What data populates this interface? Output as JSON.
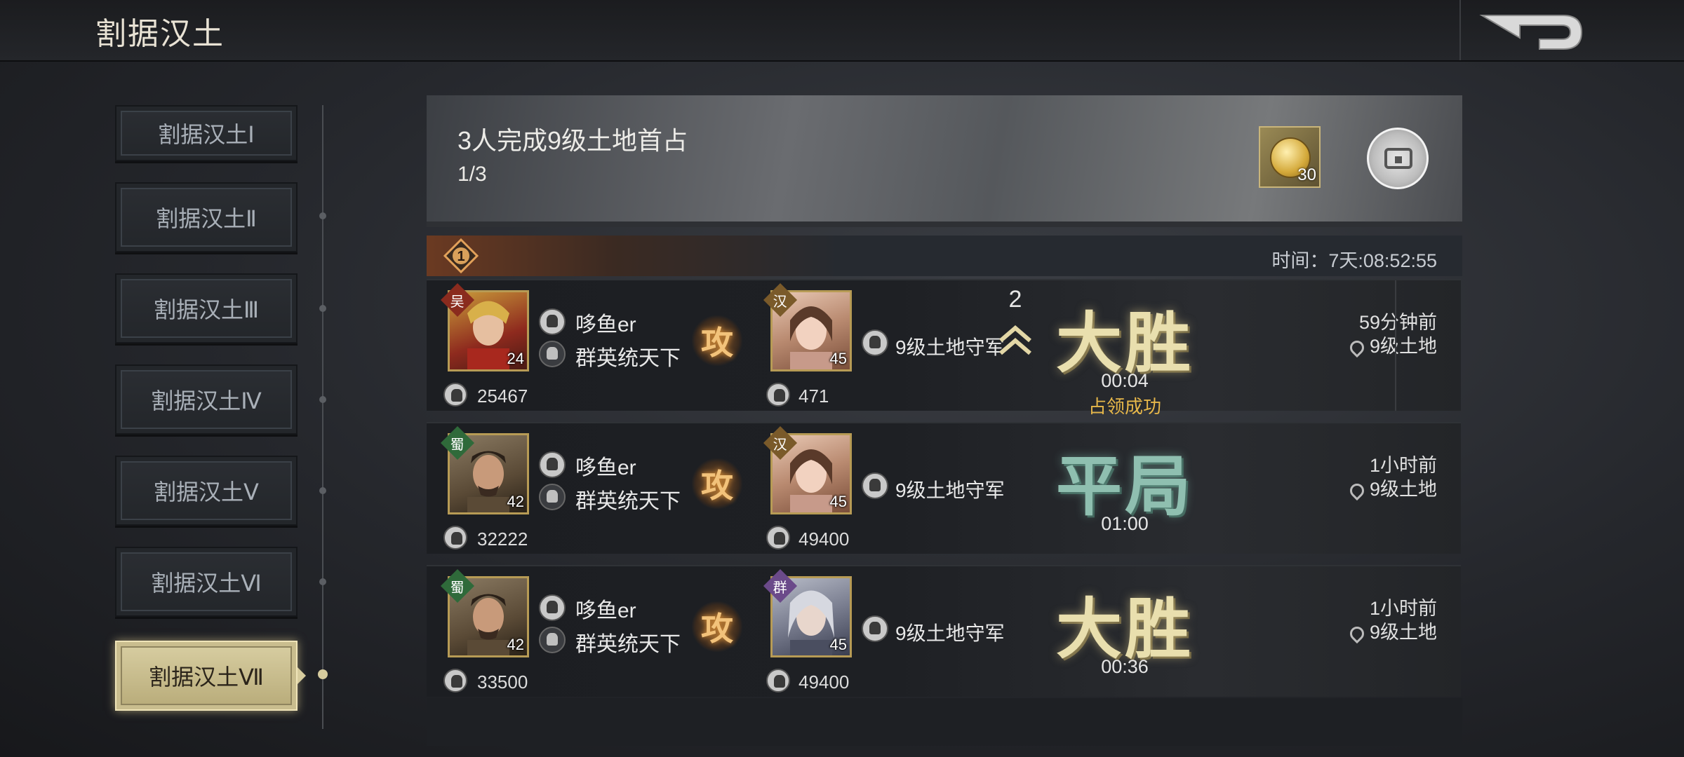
{
  "header": {
    "title": "割据汉土"
  },
  "sidebar": {
    "items": [
      {
        "label": "割据汉土Ⅰ"
      },
      {
        "label": "割据汉土Ⅱ"
      },
      {
        "label": "割据汉土Ⅲ"
      },
      {
        "label": "割据汉土Ⅳ"
      },
      {
        "label": "割据汉土Ⅴ"
      },
      {
        "label": "割据汉土Ⅵ"
      },
      {
        "label": "割据汉土Ⅶ"
      }
    ],
    "active_index": 6
  },
  "banner": {
    "title": "3人完成9级土地首占",
    "progress": "1/3",
    "reward_count": "30",
    "reward_icon": "gold-coin-icon",
    "chest_icon": "treasure-chest-icon"
  },
  "round": {
    "number": "1",
    "time_label": "时间：7天:08:52:55"
  },
  "battles": [
    {
      "attacker_faction": "吴",
      "attacker_level": "24",
      "attacker_name": "哆鱼er",
      "attacker_alliance": "群英统天下",
      "attacker_power": "25467",
      "attack_label": "攻",
      "defender_faction": "汉",
      "defender_level": "45",
      "defender_name": "9级土地守军",
      "defender_power": "471",
      "result": "大胜",
      "duration": "00:04",
      "status": "占领成功",
      "time_ago": "59分钟前",
      "location": "9级土地"
    },
    {
      "attacker_faction": "蜀",
      "attacker_level": "42",
      "attacker_name": "哆鱼er",
      "attacker_alliance": "群英统天下",
      "attacker_power": "32222",
      "attack_label": "攻",
      "defender_faction": "汉",
      "defender_level": "45",
      "defender_name": "9级土地守军",
      "defender_power": "49400",
      "result": "平局",
      "duration": "01:00",
      "time_ago": "1小时前",
      "location": "9级土地"
    },
    {
      "attacker_faction": "蜀",
      "attacker_level": "42",
      "attacker_name": "哆鱼er",
      "attacker_alliance": "群英统天下",
      "attacker_power": "33500",
      "attack_label": "攻",
      "defender_faction": "群",
      "defender_level": "45",
      "defender_name": "9级土地守军",
      "defender_power": "49400",
      "result": "大胜",
      "duration": "00:36",
      "time_ago": "1小时前",
      "location": "9级土地"
    }
  ],
  "group": {
    "count": "2"
  },
  "colors": {
    "gold": "#e9dfae",
    "draw": "#8fbfb0",
    "occupy": "#e6b74a",
    "active_tab": "#d9cfa3"
  }
}
